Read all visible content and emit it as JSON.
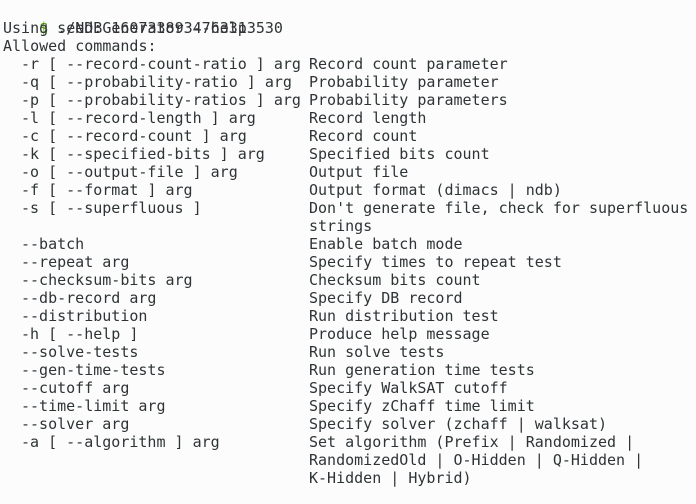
{
  "terminal": {
    "prompt_symbol": "$",
    "command": "./NDBGenerator --help",
    "seed_line": "Using seed: 1607338934763313530",
    "allowed_header": "Allowed commands:",
    "options": [
      {
        "flag": "-r [ --record-count-ratio ] arg",
        "desc": [
          "Record count parameter"
        ]
      },
      {
        "flag": "-q [ --probability-ratio ] arg",
        "desc": [
          "Probability parameter"
        ]
      },
      {
        "flag": "-p [ --probability-ratios ] arg",
        "desc": [
          "Probability parameters"
        ]
      },
      {
        "flag": "-l [ --record-length ] arg",
        "desc": [
          "Record length"
        ]
      },
      {
        "flag": "-c [ --record-count ] arg",
        "desc": [
          "Record count"
        ]
      },
      {
        "flag": "-k [ --specified-bits ] arg",
        "desc": [
          "Specified bits count"
        ]
      },
      {
        "flag": "-o [ --output-file ] arg",
        "desc": [
          "Output file"
        ]
      },
      {
        "flag": "-f [ --format ] arg",
        "desc": [
          "Output format (dimacs | ndb)"
        ]
      },
      {
        "flag": "-s [ --superfluous ]",
        "desc": [
          "Don't generate file, check for superfluous",
          "strings"
        ]
      },
      {
        "flag": "--batch",
        "desc": [
          "Enable batch mode"
        ]
      },
      {
        "flag": "--repeat arg",
        "desc": [
          "Specify times to repeat test"
        ]
      },
      {
        "flag": "--checksum-bits arg",
        "desc": [
          "Checksum bits count"
        ]
      },
      {
        "flag": "--db-record arg",
        "desc": [
          "Specify DB record"
        ]
      },
      {
        "flag": "--distribution",
        "desc": [
          "Run distribution test"
        ]
      },
      {
        "flag": "-h [ --help ]",
        "desc": [
          "Produce help message"
        ]
      },
      {
        "flag": "--solve-tests",
        "desc": [
          "Run solve tests"
        ]
      },
      {
        "flag": "--gen-time-tests",
        "desc": [
          "Run generation time tests"
        ]
      },
      {
        "flag": "--cutoff arg",
        "desc": [
          "Specify WalkSAT cutoff"
        ]
      },
      {
        "flag": "--time-limit arg",
        "desc": [
          "Specify zChaff time limit"
        ]
      },
      {
        "flag": "--solver arg",
        "desc": [
          "Specify solver (zchaff | walksat)"
        ]
      },
      {
        "flag": "-a [ --algorithm ] arg",
        "desc": [
          "Set algorithm (Prefix | Randomized |",
          "RandomizedOld | O-Hidden | Q-Hidden |",
          "K-Hidden | Hybrid)"
        ]
      }
    ]
  },
  "colors": {
    "background": "#fcfcfc",
    "text": "#2e3436",
    "prompt": "#4e9a06"
  }
}
